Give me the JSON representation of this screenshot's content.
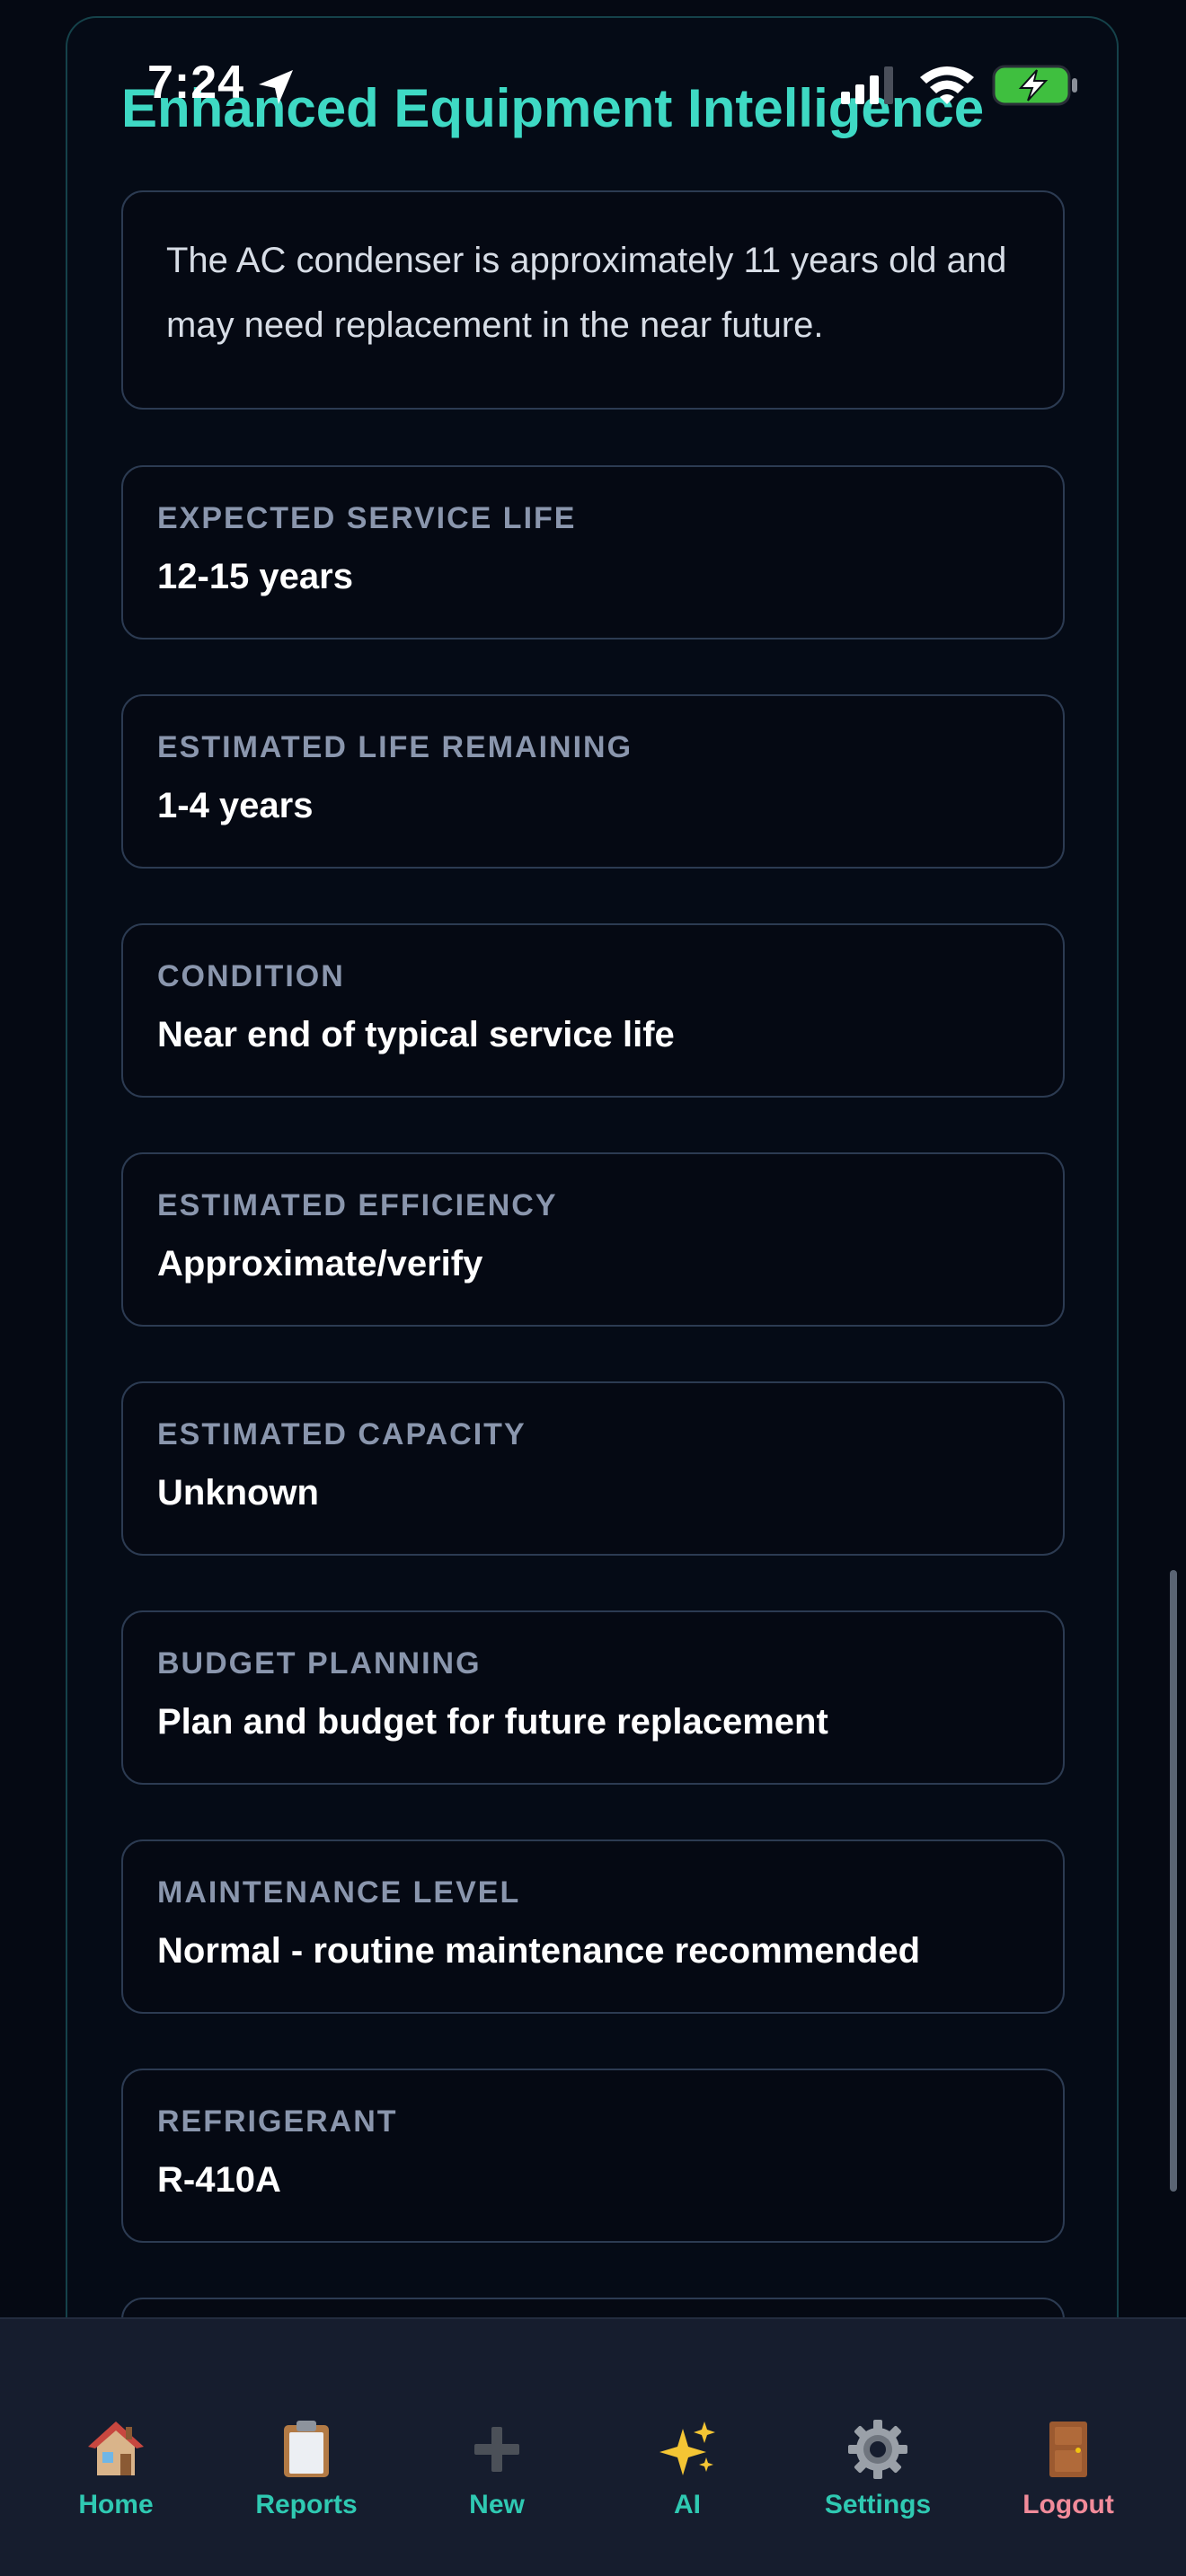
{
  "status_bar": {
    "time": "7:24",
    "icons": [
      "location-arrow-icon",
      "cellular-signal-icon",
      "wifi-icon",
      "battery-charging-icon"
    ]
  },
  "section": {
    "title": "Enhanced Equipment Intelligence",
    "summary": "The AC condenser is approximately 11 years old and may need replacement in the near future."
  },
  "cards": [
    {
      "label": "EXPECTED SERVICE LIFE",
      "value": "12-15 years"
    },
    {
      "label": "ESTIMATED LIFE REMAINING",
      "value": "1-4 years"
    },
    {
      "label": "CONDITION",
      "value": "Near end of typical service life"
    },
    {
      "label": "ESTIMATED EFFICIENCY",
      "value": "Approximate/verify"
    },
    {
      "label": "ESTIMATED CAPACITY",
      "value": "Unknown"
    },
    {
      "label": "BUDGET PLANNING",
      "value": "Plan and budget for future replacement"
    },
    {
      "label": "MAINTENANCE LEVEL",
      "value": "Normal - routine maintenance recommended"
    },
    {
      "label": "REFRIGERANT",
      "value": "R-410A"
    }
  ],
  "tabbar": {
    "tabs": [
      {
        "label": "Home",
        "icon": "house-icon"
      },
      {
        "label": "Reports",
        "icon": "clipboard-icon"
      },
      {
        "label": "New",
        "icon": "plus-icon"
      },
      {
        "label": "AI",
        "icon": "sparkles-icon"
      },
      {
        "label": "Settings",
        "icon": "gear-icon"
      },
      {
        "label": "Logout",
        "icon": "door-icon"
      }
    ]
  },
  "colors": {
    "accent": "#3ed9c4",
    "tab_label": "#2fc9b2",
    "logout": "#f28b9a",
    "background": "#050913",
    "card_border": "#2c3b52",
    "label_gray": "#8a96ad"
  }
}
